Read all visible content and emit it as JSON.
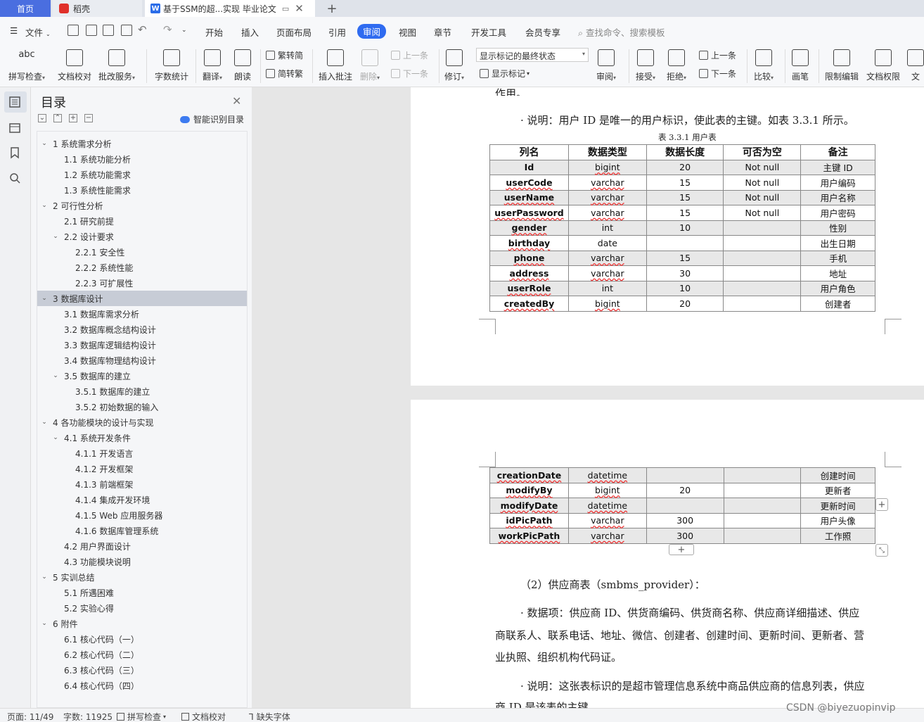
{
  "tabs": {
    "home": "首页",
    "daoke": "稻壳",
    "doc_title": "基于SSM的超...实现 毕业论文",
    "new_tab": "+"
  },
  "menu": {
    "file": "文件",
    "items": [
      "开始",
      "插入",
      "页面布局",
      "引用",
      "审阅",
      "视图",
      "章节",
      "开发工具",
      "会员专享"
    ],
    "active_index": 4,
    "search": "查找命令、搜索模板"
  },
  "ribbon": {
    "spell": "拼写检查",
    "proof": "文档校对",
    "batch": "批改服务",
    "wordcount": "字数统计",
    "translate": "翻译",
    "read": "朗读",
    "to_trad": "繁转简",
    "to_simp": "简转繁",
    "insert_comment": "插入批注",
    "delete": "删除",
    "prev": "上一条",
    "next": "下一条",
    "revise": "修订",
    "markup_state": "显示标记的最终状态",
    "show_markup": "显示标记",
    "review": "审阅",
    "accept": "接受",
    "reject": "拒绝",
    "prev2": "上一条",
    "next2": "下一条",
    "compare": "比较",
    "pen": "画笔",
    "restrict": "限制编辑",
    "permission": "文档权限",
    "doc_cut": "文"
  },
  "toc": {
    "title": "目录",
    "smart": "智能识别目录",
    "items": [
      {
        "text": "1  系统需求分析",
        "level": 1,
        "arrow": "⌄"
      },
      {
        "text": "1.1  系统功能分析",
        "level": 2,
        "arrow": ""
      },
      {
        "text": "1.2  系统功能需求",
        "level": 2,
        "arrow": ""
      },
      {
        "text": "1.3  系统性能需求",
        "level": 2,
        "arrow": ""
      },
      {
        "text": "2  可行性分析",
        "level": 1,
        "arrow": "⌄"
      },
      {
        "text": "2.1  研究前提",
        "level": 2,
        "arrow": ""
      },
      {
        "text": "2.2  设计要求",
        "level": 2,
        "arrow": "⌄"
      },
      {
        "text": "2.2.1  安全性",
        "level": 3,
        "arrow": ""
      },
      {
        "text": "2.2.2  系统性能",
        "level": 3,
        "arrow": ""
      },
      {
        "text": "2.2.3  可扩展性",
        "level": 3,
        "arrow": ""
      },
      {
        "text": "3  数据库设计",
        "level": 1,
        "arrow": "⌄",
        "selected": true
      },
      {
        "text": "3.1  数据库需求分析",
        "level": 2,
        "arrow": ""
      },
      {
        "text": "3.2  数据库概念结构设计",
        "level": 2,
        "arrow": ""
      },
      {
        "text": "3.3  数据库逻辑结构设计",
        "level": 2,
        "arrow": ""
      },
      {
        "text": "3.4  数据库物理结构设计",
        "level": 2,
        "arrow": ""
      },
      {
        "text": "3.5  数据库的建立",
        "level": 2,
        "arrow": "⌄"
      },
      {
        "text": "3.5.1  数据库的建立",
        "level": 3,
        "arrow": ""
      },
      {
        "text": "3.5.2  初始数据的输入",
        "level": 3,
        "arrow": ""
      },
      {
        "text": "4  各功能模块的设计与实现",
        "level": 1,
        "arrow": "⌄"
      },
      {
        "text": "4.1  系统开发条件",
        "level": 2,
        "arrow": "⌄"
      },
      {
        "text": "4.1.1  开发语言",
        "level": 3,
        "arrow": ""
      },
      {
        "text": "4.1.2  开发框架",
        "level": 3,
        "arrow": ""
      },
      {
        "text": "4.1.3  前端框架",
        "level": 3,
        "arrow": ""
      },
      {
        "text": "4.1.4  集成开发环境",
        "level": 3,
        "arrow": ""
      },
      {
        "text": "4.1.5 Web 应用服务器",
        "level": 3,
        "arrow": ""
      },
      {
        "text": "4.1.6  数据库管理系统",
        "level": 3,
        "arrow": ""
      },
      {
        "text": "4.2  用户界面设计",
        "level": 2,
        "arrow": ""
      },
      {
        "text": "4.3  功能模块说明",
        "level": 2,
        "arrow": ""
      },
      {
        "text": "5  实训总结",
        "level": 1,
        "arrow": "⌄"
      },
      {
        "text": "5.1  所遇困难",
        "level": 2,
        "arrow": ""
      },
      {
        "text": "5.2  实验心得",
        "level": 2,
        "arrow": ""
      },
      {
        "text": "6  附件",
        "level": 1,
        "arrow": "⌄"
      },
      {
        "text": "6.1  核心代码（一）",
        "level": 2,
        "arrow": ""
      },
      {
        "text": "6.2  核心代码（二）",
        "level": 2,
        "arrow": ""
      },
      {
        "text": "6.3  核心代码（三）",
        "level": 2,
        "arrow": ""
      },
      {
        "text": "6.4  核心代码（四）",
        "level": 2,
        "arrow": ""
      }
    ]
  },
  "doc": {
    "top_cut": "作用。",
    "note1": "· 说明：用户 ID 是唯一的用户标识，使此表的主键。如表 3.3.1 所示。",
    "caption": "表 3.3.1  用户表",
    "headers": [
      "列名",
      "数据类型",
      "数据长度",
      "可否为空",
      "备注"
    ],
    "rows1": [
      [
        "Id",
        "bigint",
        "20",
        "Not null",
        "主键 ID"
      ],
      [
        "userCode",
        "varchar",
        "15",
        "Not null",
        "用户编码"
      ],
      [
        "userName",
        "varchar",
        "15",
        "Not null",
        "用户名称"
      ],
      [
        "userPassword",
        "varchar",
        "15",
        "Not null",
        "用户密码"
      ],
      [
        "gender",
        "int",
        "10",
        "",
        "性别"
      ],
      [
        "birthday",
        "date",
        "",
        "",
        "出生日期"
      ],
      [
        "phone",
        "varchar",
        "15",
        "",
        "手机"
      ],
      [
        "address",
        "varchar",
        "30",
        "",
        "地址"
      ],
      [
        "userRole",
        "int",
        "10",
        "",
        "用户角色"
      ],
      [
        "createdBy",
        "bigint",
        "20",
        "",
        "创建者"
      ]
    ],
    "rows2": [
      [
        "creationDate",
        "datetime",
        "",
        "",
        "创建时间"
      ],
      [
        "modifyBy",
        "bigint",
        "20",
        "",
        "更新者"
      ],
      [
        "modifyDate",
        "datetime",
        "",
        "",
        "更新时间"
      ],
      [
        "idPicPath",
        "varchar",
        "300",
        "",
        "用户头像"
      ],
      [
        "workPicPath",
        "varchar",
        "300",
        "",
        "工作照"
      ]
    ],
    "provider_title": "（2）供应商表（smbms_provider）：",
    "items_line1": "· 数据项：供应商 ID、供货商编码、供货商名称、供应商详细描述、供应",
    "items_line2": "商联系人、联系电话、地址、微信、创建者、创建时间、更新时间、更新者、营",
    "items_line3": "业执照、组织机构代码证。",
    "note2": "· 说明：这张表标识的是超市管理信息系统中商品供应商的信息列表，供应",
    "bottom_cut": "商 ID 是该表的主键"
  },
  "status": {
    "page": "页面: 11/49",
    "words": "字数: 11925",
    "spell": "拼写检查",
    "proof": "文档校对",
    "missing_font": "缺失字体"
  },
  "watermark": "CSDN @biyezuopinvip"
}
